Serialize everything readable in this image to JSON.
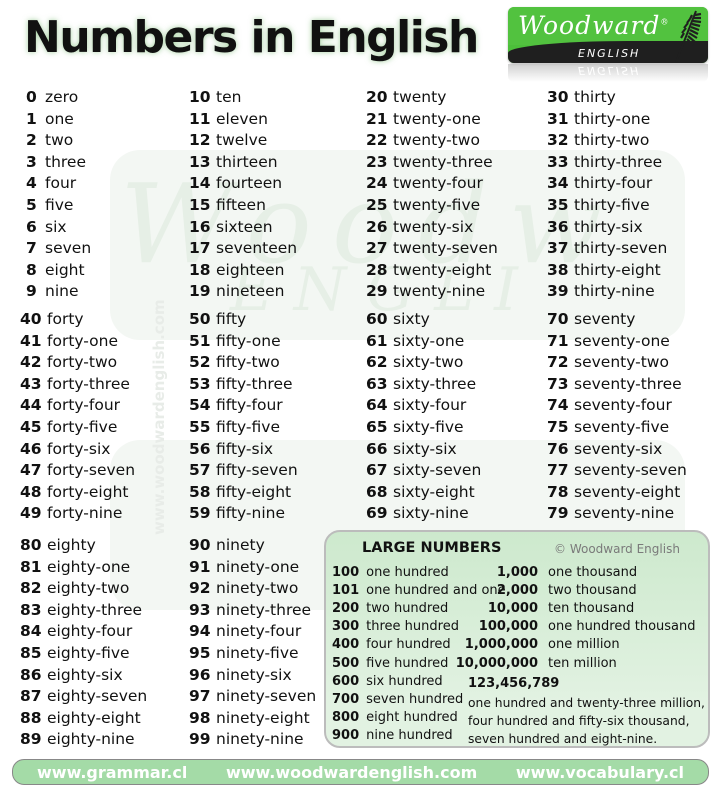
{
  "title": "Numbers in English",
  "logo": {
    "brand": "Woodward",
    "sub": "ENGLISH",
    "registered": "®"
  },
  "watermark": {
    "vertical": "www.woodwardenglish.com",
    "script1": "Woodw",
    "script2": "ENGLI"
  },
  "columns": [
    {
      "items": [
        {
          "n": "0",
          "w": "zero"
        },
        {
          "n": "1",
          "w": "one"
        },
        {
          "n": "2",
          "w": "two"
        },
        {
          "n": "3",
          "w": "three"
        },
        {
          "n": "4",
          "w": "four"
        },
        {
          "n": "5",
          "w": "five"
        },
        {
          "n": "6",
          "w": "six"
        },
        {
          "n": "7",
          "w": "seven"
        },
        {
          "n": "8",
          "w": "eight"
        },
        {
          "n": "9",
          "w": "nine"
        }
      ]
    },
    {
      "items": [
        {
          "n": "10",
          "w": "ten"
        },
        {
          "n": "11",
          "w": "eleven"
        },
        {
          "n": "12",
          "w": "twelve"
        },
        {
          "n": "13",
          "w": "thirteen"
        },
        {
          "n": "14",
          "w": "fourteen"
        },
        {
          "n": "15",
          "w": "fifteen"
        },
        {
          "n": "16",
          "w": "sixteen"
        },
        {
          "n": "17",
          "w": "seventeen"
        },
        {
          "n": "18",
          "w": "eighteen"
        },
        {
          "n": "19",
          "w": "nineteen"
        }
      ]
    },
    {
      "items": [
        {
          "n": "20",
          "w": "twenty"
        },
        {
          "n": "21",
          "w": "twenty-one"
        },
        {
          "n": "22",
          "w": "twenty-two"
        },
        {
          "n": "23",
          "w": "twenty-three"
        },
        {
          "n": "24",
          "w": "twenty-four"
        },
        {
          "n": "25",
          "w": "twenty-five"
        },
        {
          "n": "26",
          "w": "twenty-six"
        },
        {
          "n": "27",
          "w": "twenty-seven"
        },
        {
          "n": "28",
          "w": "twenty-eight"
        },
        {
          "n": "29",
          "w": "twenty-nine"
        }
      ]
    },
    {
      "items": [
        {
          "n": "30",
          "w": "thirty"
        },
        {
          "n": "31",
          "w": "thirty-one"
        },
        {
          "n": "32",
          "w": "thirty-two"
        },
        {
          "n": "33",
          "w": "thirty-three"
        },
        {
          "n": "34",
          "w": "thirty-four"
        },
        {
          "n": "35",
          "w": "thirty-five"
        },
        {
          "n": "36",
          "w": "thirty-six"
        },
        {
          "n": "37",
          "w": "thirty-seven"
        },
        {
          "n": "38",
          "w": "thirty-eight"
        },
        {
          "n": "39",
          "w": "thirty-nine"
        }
      ]
    },
    {
      "items": [
        {
          "n": "40",
          "w": "forty"
        },
        {
          "n": "41",
          "w": "forty-one"
        },
        {
          "n": "42",
          "w": "forty-two"
        },
        {
          "n": "43",
          "w": "forty-three"
        },
        {
          "n": "44",
          "w": "forty-four"
        },
        {
          "n": "45",
          "w": "forty-five"
        },
        {
          "n": "46",
          "w": "forty-six"
        },
        {
          "n": "47",
          "w": "forty-seven"
        },
        {
          "n": "48",
          "w": "forty-eight"
        },
        {
          "n": "49",
          "w": "forty-nine"
        }
      ]
    },
    {
      "items": [
        {
          "n": "50",
          "w": "fifty"
        },
        {
          "n": "51",
          "w": "fifty-one"
        },
        {
          "n": "52",
          "w": "fifty-two"
        },
        {
          "n": "53",
          "w": "fifty-three"
        },
        {
          "n": "54",
          "w": "fifty-four"
        },
        {
          "n": "55",
          "w": "fifty-five"
        },
        {
          "n": "56",
          "w": "fifty-six"
        },
        {
          "n": "57",
          "w": "fifty-seven"
        },
        {
          "n": "58",
          "w": "fifty-eight"
        },
        {
          "n": "59",
          "w": "fifty-nine"
        }
      ]
    },
    {
      "items": [
        {
          "n": "60",
          "w": "sixty"
        },
        {
          "n": "61",
          "w": "sixty-one"
        },
        {
          "n": "62",
          "w": "sixty-two"
        },
        {
          "n": "63",
          "w": "sixty-three"
        },
        {
          "n": "64",
          "w": "sixty-four"
        },
        {
          "n": "65",
          "w": "sixty-five"
        },
        {
          "n": "66",
          "w": "sixty-six"
        },
        {
          "n": "67",
          "w": "sixty-seven"
        },
        {
          "n": "68",
          "w": "sixty-eight"
        },
        {
          "n": "69",
          "w": "sixty-nine"
        }
      ]
    },
    {
      "items": [
        {
          "n": "70",
          "w": "seventy"
        },
        {
          "n": "71",
          "w": "seventy-one"
        },
        {
          "n": "72",
          "w": "seventy-two"
        },
        {
          "n": "73",
          "w": "seventy-three"
        },
        {
          "n": "74",
          "w": "seventy-four"
        },
        {
          "n": "75",
          "w": "seventy-five"
        },
        {
          "n": "76",
          "w": "seventy-six"
        },
        {
          "n": "77",
          "w": "seventy-seven"
        },
        {
          "n": "78",
          "w": "seventy-eight"
        },
        {
          "n": "79",
          "w": "seventy-nine"
        }
      ]
    },
    {
      "items": [
        {
          "n": "80",
          "w": "eighty"
        },
        {
          "n": "81",
          "w": "eighty-one"
        },
        {
          "n": "82",
          "w": "eighty-two"
        },
        {
          "n": "83",
          "w": "eighty-three"
        },
        {
          "n": "84",
          "w": "eighty-four"
        },
        {
          "n": "85",
          "w": "eighty-five"
        },
        {
          "n": "86",
          "w": "eighty-six"
        },
        {
          "n": "87",
          "w": "eighty-seven"
        },
        {
          "n": "88",
          "w": "eighty-eight"
        },
        {
          "n": "89",
          "w": "eighty-nine"
        }
      ]
    },
    {
      "items": [
        {
          "n": "90",
          "w": "ninety"
        },
        {
          "n": "91",
          "w": "ninety-one"
        },
        {
          "n": "92",
          "w": "ninety-two"
        },
        {
          "n": "93",
          "w": "ninety-three"
        },
        {
          "n": "94",
          "w": "ninety-four"
        },
        {
          "n": "95",
          "w": "ninety-five"
        },
        {
          "n": "96",
          "w": "ninety-six"
        },
        {
          "n": "97",
          "w": "ninety-seven"
        },
        {
          "n": "98",
          "w": "ninety-eight"
        },
        {
          "n": "99",
          "w": "ninety-nine"
        }
      ]
    }
  ],
  "large_numbers": {
    "title": "LARGE NUMBERS",
    "copyright": "© Woodward English",
    "hundreds": [
      {
        "n": "100",
        "w": "one hundred"
      },
      {
        "n": "101",
        "w": "one hundred and one"
      },
      {
        "n": "200",
        "w": "two hundred"
      },
      {
        "n": "300",
        "w": "three hundred"
      },
      {
        "n": "400",
        "w": "four hundred"
      },
      {
        "n": "500",
        "w": "five hundred"
      },
      {
        "n": "600",
        "w": "six hundred"
      },
      {
        "n": "700",
        "w": "seven hundred"
      },
      {
        "n": "800",
        "w": "eight hundred"
      },
      {
        "n": "900",
        "w": "nine hundred"
      }
    ],
    "thousands": [
      {
        "n": "1,000",
        "w": "one thousand"
      },
      {
        "n": "2,000",
        "w": "two thousand"
      },
      {
        "n": "10,000",
        "w": "ten thousand"
      },
      {
        "n": "100,000",
        "w": "one hundred thousand"
      },
      {
        "n": "1,000,000",
        "w": "one million"
      },
      {
        "n": "10,000,000",
        "w": "ten million"
      }
    ],
    "example_number": "123,456,789",
    "example_text": "one hundred and twenty-three million, four hundred and fifty-six thousand, seven hundred and eight-nine."
  },
  "footer": {
    "links": [
      "www.grammar.cl",
      "www.woodwardenglish.com",
      "www.vocabulary.cl"
    ]
  },
  "colors": {
    "brand_green": "#52c23f",
    "footer_green": "#a4dba7",
    "box_green": "#d5edd5"
  }
}
